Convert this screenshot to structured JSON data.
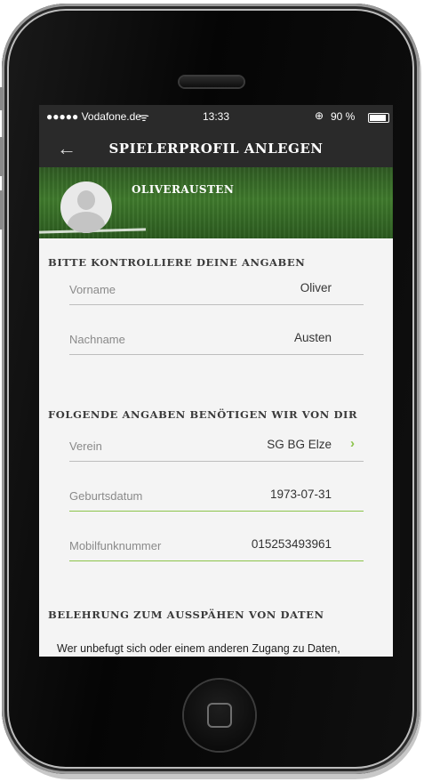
{
  "statusbar": {
    "carrier": "●●●●● Vodafone.de",
    "time": "13:33",
    "battery": "90 %",
    "battery_level": 0.9
  },
  "appbar": {
    "back_icon": "back-arrow-icon",
    "title": "SPIELERPROFIL ANLEGEN"
  },
  "profile": {
    "name": "OLIVERAUSTEN"
  },
  "section1": {
    "title": "BITTE KONTROLLIERE DEINE ANGABEN",
    "fields": [
      {
        "label": "Vorname",
        "value": "Oliver"
      },
      {
        "label": "Nachname",
        "value": "Austen"
      }
    ]
  },
  "section2": {
    "title": "FOLGENDE ANGABEN BENÖTIGEN WIR VON DIR",
    "fields": [
      {
        "label": "Verein",
        "value": "SG BG Elze"
      },
      {
        "label": "Geburtsdatum",
        "value": "1973-07-31"
      },
      {
        "label": "Mobilfunknummer",
        "value": "015253493961"
      }
    ]
  },
  "section3": {
    "title": "BELEHRUNG ZUM AUSSPÄHEN VON DATEN",
    "text": "Wer unbefugt sich oder einem anderen Zugang zu Daten,"
  },
  "colors": {
    "accent": "#8bc34a",
    "bar": "#2a2a2a"
  }
}
